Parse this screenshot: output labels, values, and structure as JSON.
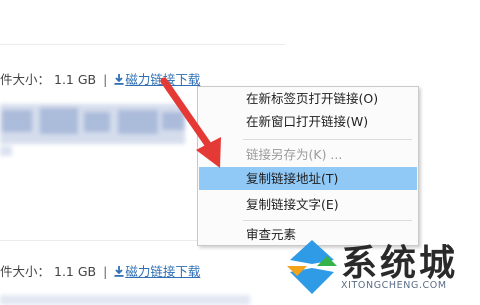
{
  "download_rows": [
    {
      "size_label": "件大小：",
      "size_value": "1.1 GB",
      "separator": "|",
      "link_text": "磁力链接下载"
    },
    {
      "size_label": "件大小：",
      "size_value": "1.1 GB",
      "separator": "|",
      "link_text": "磁力链接下载"
    }
  ],
  "context_menu": {
    "items": [
      {
        "label": "在新标签页打开链接(O)",
        "state": "normal"
      },
      {
        "label": "在新窗口打开链接(W)",
        "state": "normal"
      },
      {
        "label": "链接另存为(K) ...",
        "state": "disabled"
      },
      {
        "label": "复制链接地址(T)",
        "state": "highlighted"
      },
      {
        "label": "复制链接文字(E)",
        "state": "normal"
      },
      {
        "label": "审查元素",
        "state": "normal"
      }
    ],
    "highlight_color": "#90c8f6"
  },
  "annotation": {
    "color": "#e53935",
    "icon": "red-arrow-icon"
  },
  "link_color": "#2e6fb5",
  "watermark": {
    "title": "系统城",
    "subtitle": "XITONGCHENG.COM"
  }
}
